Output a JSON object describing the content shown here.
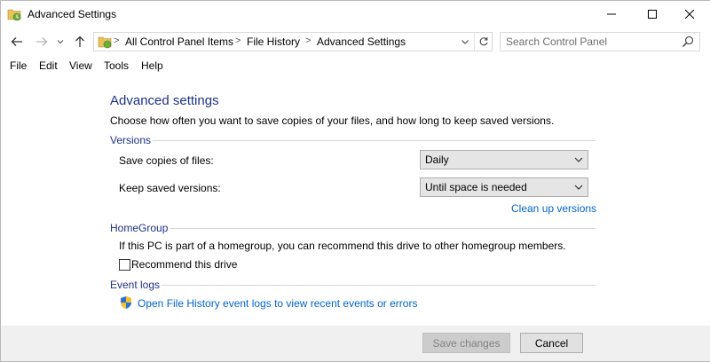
{
  "window": {
    "title": "Advanced Settings",
    "icon": "file-history-icon"
  },
  "address_bar": {
    "breadcrumbs": [
      "All Control Panel Items",
      "File History",
      "Advanced Settings"
    ],
    "separator": ">",
    "search_placeholder": "Search Control Panel"
  },
  "menu": {
    "items": [
      "File",
      "Edit",
      "View",
      "Tools",
      "Help"
    ]
  },
  "content": {
    "heading": "Advanced settings",
    "description": "Choose how often you want to save copies of your files, and how long to keep saved versions.",
    "versions": {
      "label": "Versions",
      "save_copies_label": "Save copies of files:",
      "save_copies_value": "Daily",
      "keep_versions_label": "Keep saved versions:",
      "keep_versions_value": "Until space is needed",
      "cleanup_link": "Clean up versions"
    },
    "homegroup": {
      "label": "HomeGroup",
      "description": "If this PC is part of a homegroup, you can recommend this drive to other homegroup members.",
      "recommend_label": "Recommend this drive",
      "recommend_checked": false
    },
    "event_logs": {
      "label": "Event logs",
      "link": "Open File History event logs to view recent events or errors"
    }
  },
  "footer": {
    "save_label": "Save changes",
    "cancel_label": "Cancel"
  },
  "colors": {
    "heading": "#1e3287",
    "link": "#0066cc",
    "footer_bg": "#f0f0f0"
  }
}
